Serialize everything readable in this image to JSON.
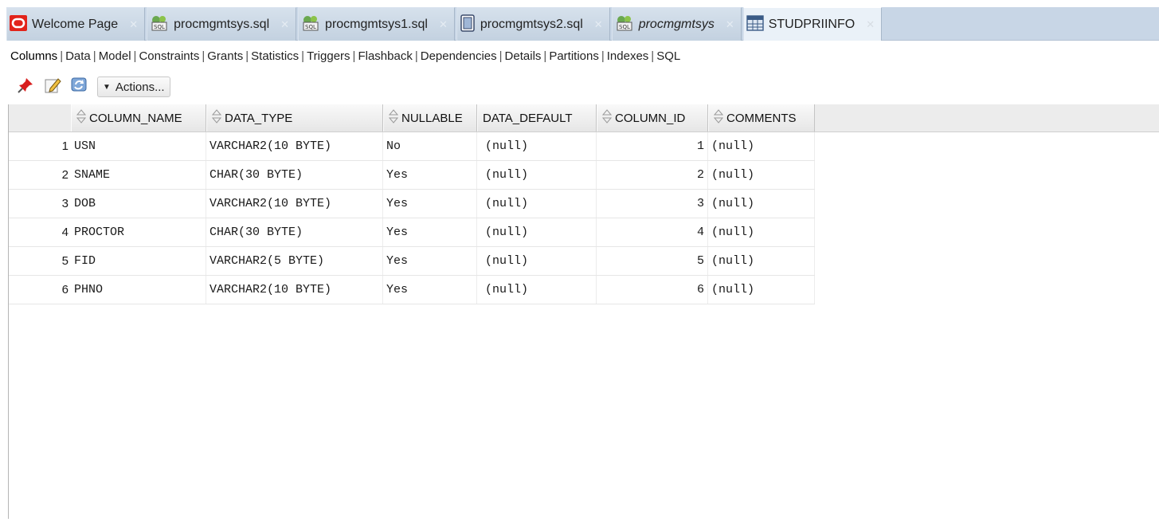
{
  "editor_tabs": [
    {
      "label": "Welcome Page",
      "icon": "oracle-logo-icon",
      "italic": false,
      "active": false
    },
    {
      "label": "procmgmtsys.sql",
      "icon": "sql-worksheet-icon",
      "italic": false,
      "active": false
    },
    {
      "label": "procmgmtsys1.sql",
      "icon": "sql-worksheet-icon",
      "italic": false,
      "active": false
    },
    {
      "label": "procmgmtsys2.sql",
      "icon": "sql-file-icon",
      "italic": false,
      "active": false
    },
    {
      "label": "procmgmtsys",
      "icon": "sql-worksheet-icon",
      "italic": true,
      "active": false
    },
    {
      "label": "STUDPRIINFO",
      "icon": "table-icon",
      "italic": false,
      "active": true
    }
  ],
  "sub_tabs": {
    "active": "Columns",
    "items": [
      "Columns",
      "Data",
      "Model",
      "Constraints",
      "Grants",
      "Statistics",
      "Triggers",
      "Flashback",
      "Dependencies",
      "Details",
      "Partitions",
      "Indexes",
      "SQL"
    ]
  },
  "toolbar": {
    "actions_label": "Actions..."
  },
  "grid": {
    "columns": [
      "COLUMN_NAME",
      "DATA_TYPE",
      "NULLABLE",
      "DATA_DEFAULT",
      "COLUMN_ID",
      "COMMENTS"
    ],
    "rows": [
      {
        "n": "1",
        "column_name": "USN",
        "data_type": "VARCHAR2(10 BYTE)",
        "nullable": "No",
        "data_default": "(null)",
        "column_id": "1",
        "comments": "(null)"
      },
      {
        "n": "2",
        "column_name": "SNAME",
        "data_type": "CHAR(30 BYTE)",
        "nullable": "Yes",
        "data_default": "(null)",
        "column_id": "2",
        "comments": "(null)"
      },
      {
        "n": "3",
        "column_name": "DOB",
        "data_type": "VARCHAR2(10 BYTE)",
        "nullable": "Yes",
        "data_default": "(null)",
        "column_id": "3",
        "comments": "(null)"
      },
      {
        "n": "4",
        "column_name": "PROCTOR",
        "data_type": "CHAR(30 BYTE)",
        "nullable": "Yes",
        "data_default": "(null)",
        "column_id": "4",
        "comments": "(null)"
      },
      {
        "n": "5",
        "column_name": "FID",
        "data_type": "VARCHAR2(5 BYTE)",
        "nullable": "Yes",
        "data_default": "(null)",
        "column_id": "5",
        "comments": "(null)"
      },
      {
        "n": "6",
        "column_name": "PHNO",
        "data_type": "VARCHAR2(10 BYTE)",
        "nullable": "Yes",
        "data_default": "(null)",
        "column_id": "6",
        "comments": "(null)"
      }
    ]
  },
  "colors": {
    "tab_strip": "#c8d6e6",
    "oracle_red": "#e2231a",
    "header_bg": "#ececec"
  }
}
